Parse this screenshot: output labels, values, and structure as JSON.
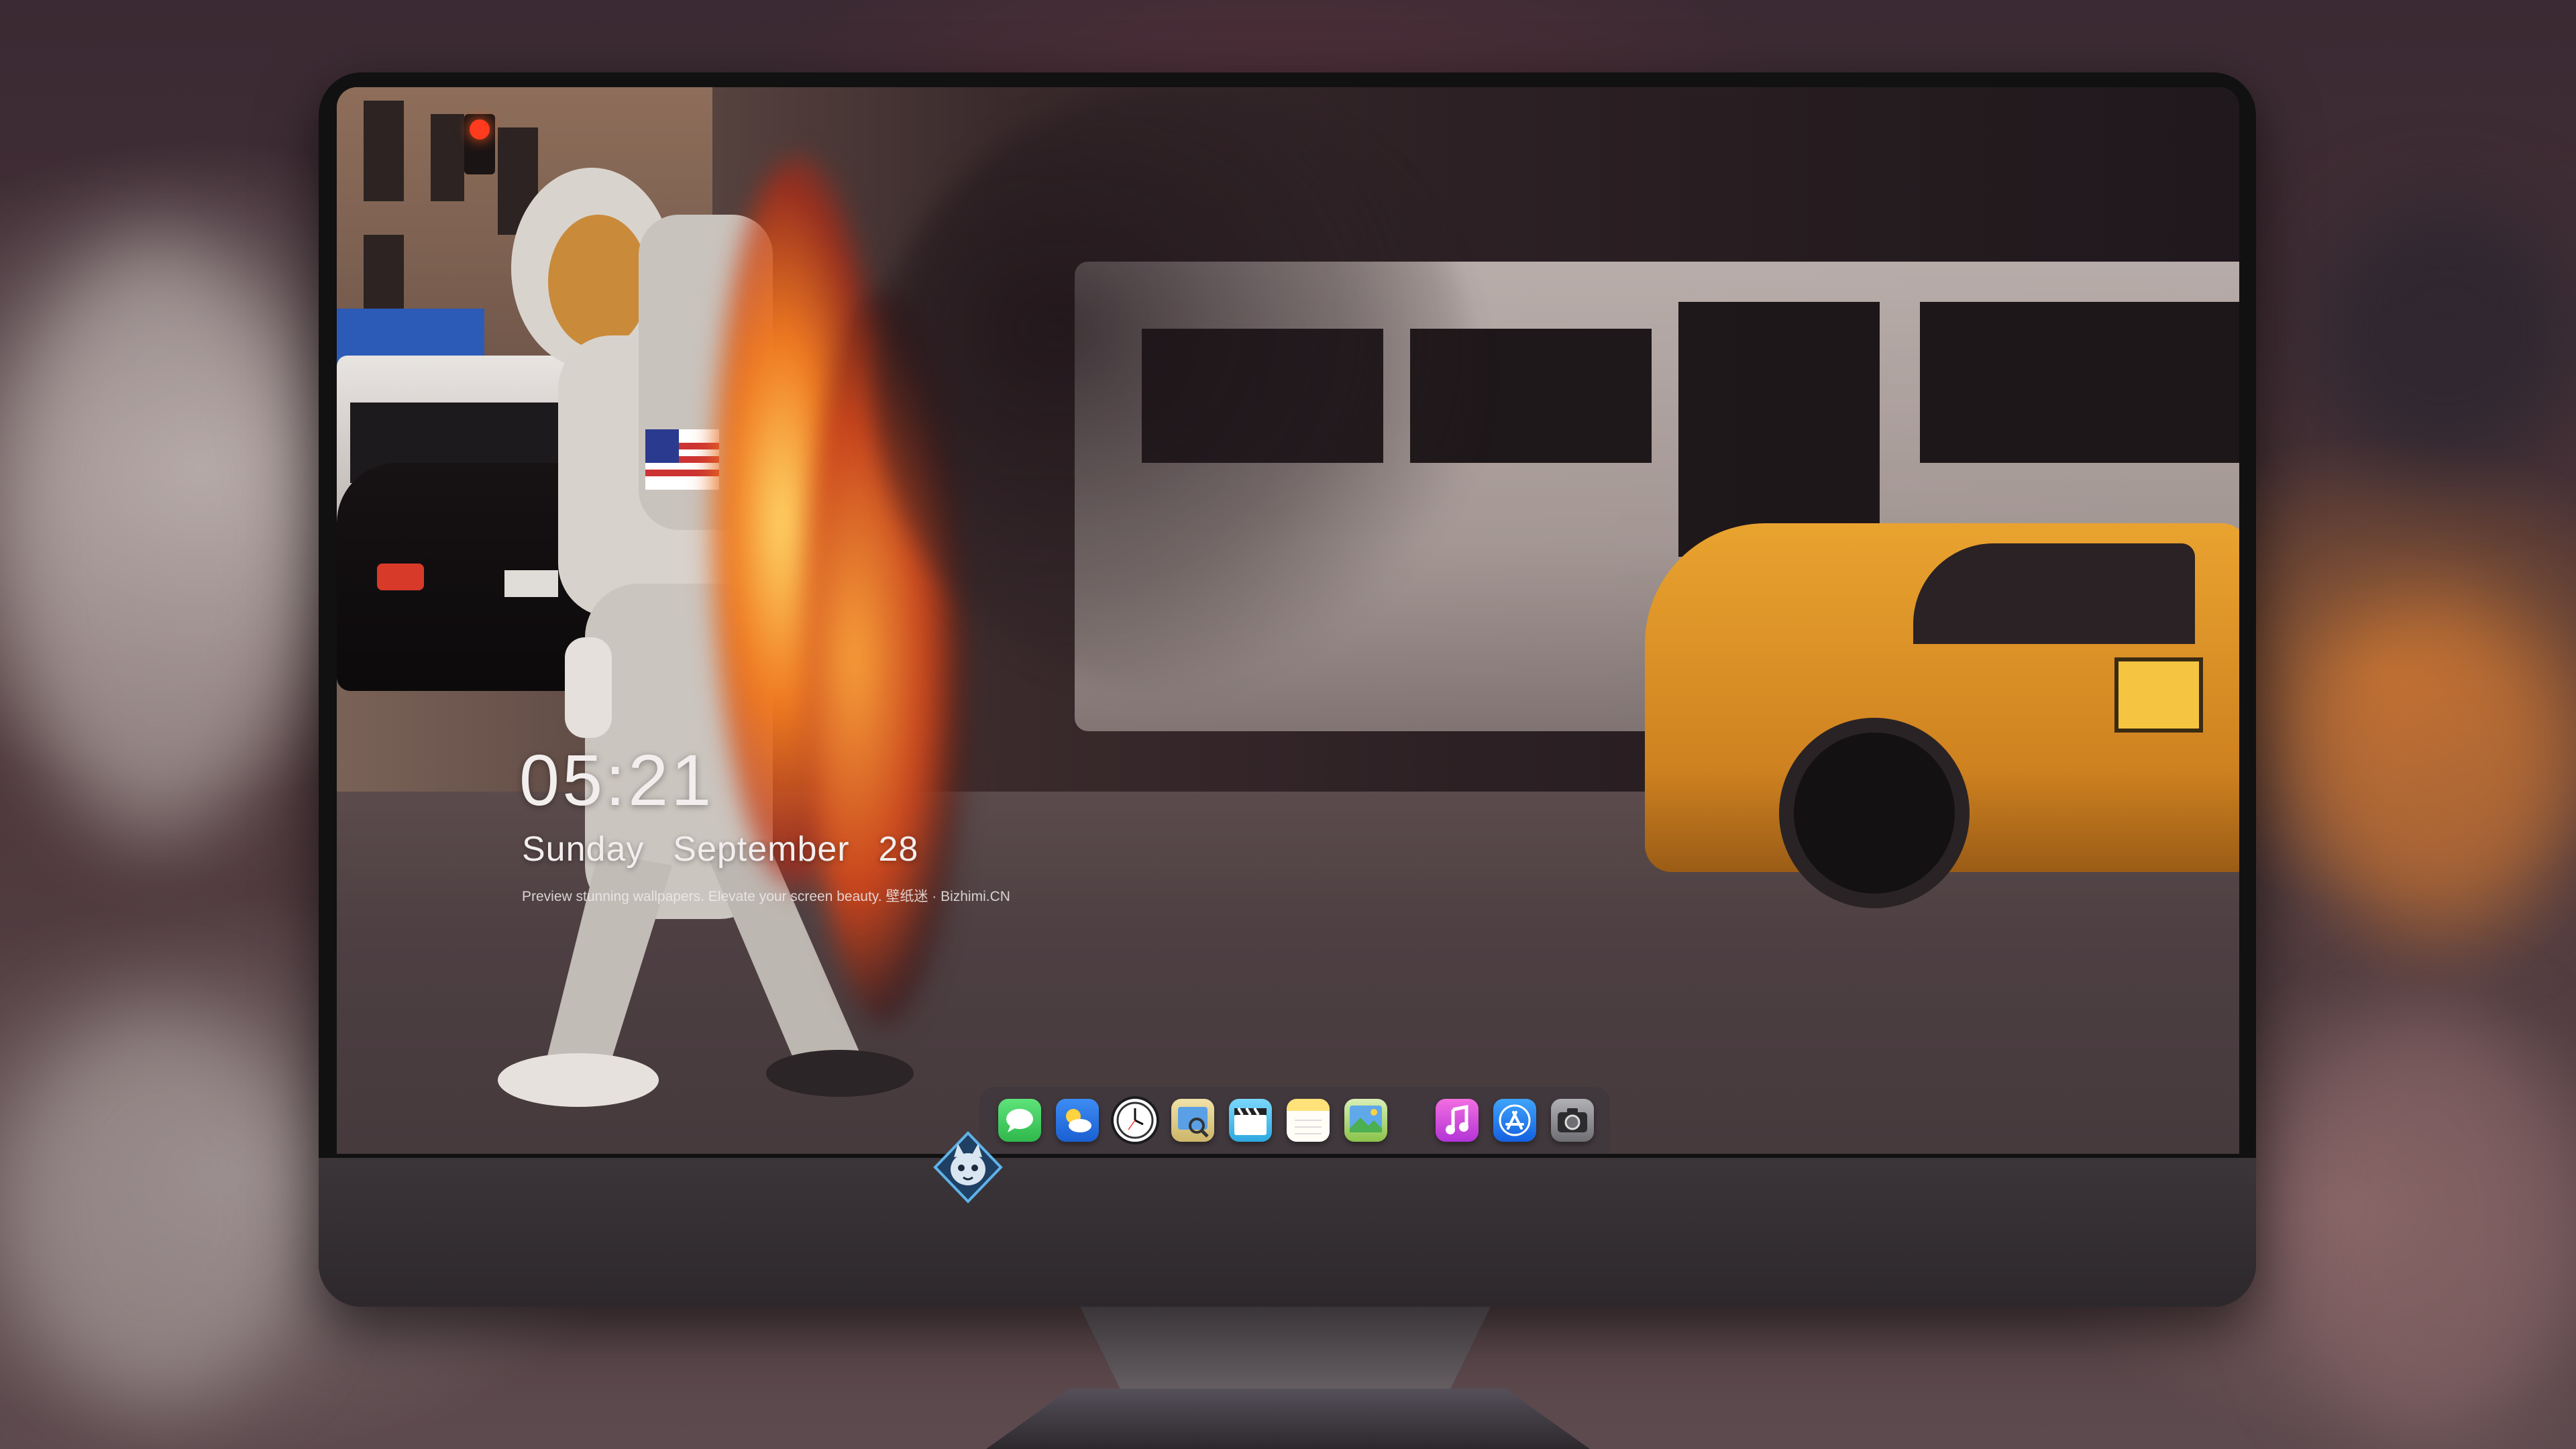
{
  "lockscreen": {
    "time": "05:21",
    "date": "Sunday  September  28",
    "tagline": "Preview stunning wallpapers. Elevate your screen beauty. 壁纸迷 · Bizhimi.CN"
  },
  "dock": {
    "apps": [
      {
        "name": "Messages",
        "icon": "messages-icon",
        "color": "#35c759"
      },
      {
        "name": "Weather",
        "icon": "weather-icon",
        "color": "#2f7ff0"
      },
      {
        "name": "Clock",
        "icon": "clock-icon",
        "color": "#1c1c1e"
      },
      {
        "name": "Preview",
        "icon": "preview-icon",
        "color": "#e8d9a0"
      },
      {
        "name": "Videos",
        "icon": "clapperboard-icon",
        "color": "#5ac8fa"
      },
      {
        "name": "Notes",
        "icon": "notes-icon",
        "color": "#ffd54a"
      },
      {
        "name": "Photos",
        "icon": "photos-icon",
        "color": "#8bc34a"
      },
      {
        "name": "Music",
        "icon": "music-icon",
        "color": "#e04bd6"
      },
      {
        "name": "App Store",
        "icon": "app-store-icon",
        "color": "#1b7cf3"
      },
      {
        "name": "Camera",
        "icon": "camera-icon",
        "color": "#8e8e93"
      }
    ]
  },
  "wallpaper": {
    "subject": "astronaut-on-fire-street",
    "accent_colors": [
      "#e9a32f",
      "#d7562a",
      "#f3eeee"
    ]
  },
  "monitor": {
    "logo": "wolf-mascot-logo",
    "body_color": "#2d282c"
  }
}
